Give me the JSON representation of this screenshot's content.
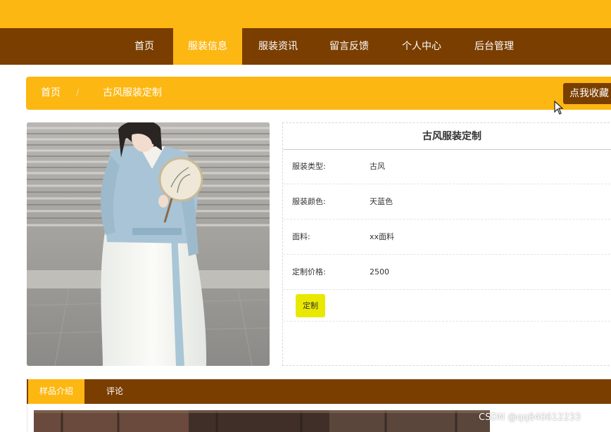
{
  "nav": {
    "items": [
      {
        "label": "首页",
        "active": false
      },
      {
        "label": "服装信息",
        "active": true
      },
      {
        "label": "服装资讯",
        "active": false
      },
      {
        "label": "留言反馈",
        "active": false
      },
      {
        "label": "个人中心",
        "active": false
      },
      {
        "label": "后台管理",
        "active": false
      }
    ]
  },
  "breadcrumb": {
    "home": "首页",
    "separator": "/",
    "current": "古风服装定制"
  },
  "favorite_button": "点我收藏",
  "product": {
    "image_alt": "古风服装定制",
    "title": "古风服装定制",
    "fields": [
      {
        "label": "服装类型:",
        "value": "古风"
      },
      {
        "label": "服装颜色:",
        "value": "天蓝色"
      },
      {
        "label": "面料:",
        "value": "xx面料"
      },
      {
        "label": "定制价格:",
        "value": "2500"
      }
    ],
    "order_button": "定制"
  },
  "tabs": [
    {
      "label": "样品介绍",
      "active": true
    },
    {
      "label": "评论",
      "active": false
    }
  ],
  "watermark": "CSDN @qq840612233",
  "colors": {
    "accent": "#fdb712",
    "nav_bg": "#7a3e00",
    "order_button": "#e8e800"
  }
}
